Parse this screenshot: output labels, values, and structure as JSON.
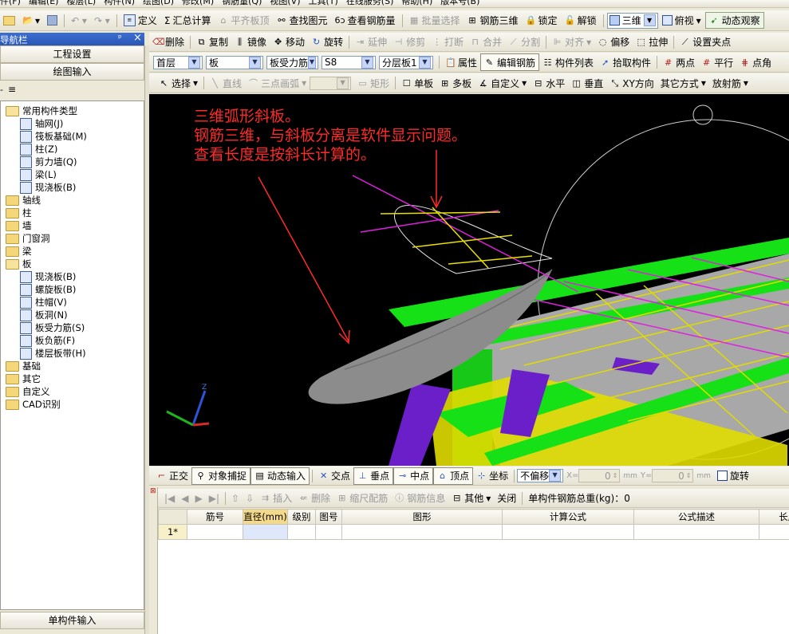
{
  "menu": [
    "件(F)",
    "编辑(E)",
    "楼层(L)",
    "构件(N)",
    "绘图(D)",
    "修改(M)",
    "钢筋量(Q)",
    "视图(V)",
    "工具(T)",
    "在线服务(S)",
    "帮助(H)",
    "版本号(B)"
  ],
  "toolbar1": {
    "define": "定义",
    "sum": "汇总计算",
    "flat_top": "平齐板顶",
    "find": "查找图元",
    "view_rebar": "查看钢筋量",
    "batch_select": "批量选择",
    "rebar_3d": "钢筋三维",
    "lock": "锁定",
    "unlock": "解锁",
    "view_mode": "三维",
    "view_angle": "俯视",
    "dynamic": "动态观察"
  },
  "toolbar2": {
    "delete": "删除",
    "copy": "复制",
    "mirror": "镜像",
    "move": "移动",
    "rotate": "旋转",
    "extend": "延伸",
    "trim": "修剪",
    "break": "打断",
    "merge": "合并",
    "split": "分割",
    "align": "对齐",
    "offset": "偏移",
    "stretch": "拉伸",
    "set_pinch": "设置夹点"
  },
  "toolbar3": {
    "floor": "首层",
    "category": "板",
    "type": "板受力筋",
    "name": "S8",
    "layer": "分层板1",
    "property": "属性",
    "edit_rebar": "编辑钢筋",
    "component_list": "构件列表",
    "pick": "拾取构件",
    "two_points": "两点",
    "parallel": "平行",
    "point_angle": "点角"
  },
  "toolbar4": {
    "select": "选择",
    "line": "直线",
    "arc": "三点画弧",
    "rect": "矩形",
    "single": "单板",
    "multi": "多板",
    "custom": "自定义",
    "horizontal": "水平",
    "vertical": "垂直",
    "xy": "XY方向",
    "other": "其它方式",
    "radial": "放射筋"
  },
  "left_panel": {
    "title": "导航栏",
    "btn_project": "工程设置",
    "btn_draw": "绘图输入",
    "btn_single": "单构件输入",
    "tree": [
      {
        "label": "常用构件类型",
        "level": 0,
        "kind": "folder-open"
      },
      {
        "label": "轴网(J)",
        "level": 1,
        "kind": "leaf"
      },
      {
        "label": "筏板基础(M)",
        "level": 1,
        "kind": "leaf"
      },
      {
        "label": "柱(Z)",
        "level": 1,
        "kind": "leaf"
      },
      {
        "label": "剪力墙(Q)",
        "level": 1,
        "kind": "leaf"
      },
      {
        "label": "梁(L)",
        "level": 1,
        "kind": "leaf"
      },
      {
        "label": "现浇板(B)",
        "level": 1,
        "kind": "leaf"
      },
      {
        "label": "轴线",
        "level": 0,
        "kind": "folder"
      },
      {
        "label": "柱",
        "level": 0,
        "kind": "folder"
      },
      {
        "label": "墙",
        "level": 0,
        "kind": "folder"
      },
      {
        "label": "门窗洞",
        "level": 0,
        "kind": "folder"
      },
      {
        "label": "梁",
        "level": 0,
        "kind": "folder"
      },
      {
        "label": "板",
        "level": 0,
        "kind": "folder-open"
      },
      {
        "label": "现浇板(B)",
        "level": 1,
        "kind": "leaf"
      },
      {
        "label": "螺旋板(B)",
        "level": 1,
        "kind": "leaf"
      },
      {
        "label": "柱帽(V)",
        "level": 1,
        "kind": "leaf"
      },
      {
        "label": "板洞(N)",
        "level": 1,
        "kind": "leaf"
      },
      {
        "label": "板受力筋(S)",
        "level": 1,
        "kind": "leaf"
      },
      {
        "label": "板负筋(F)",
        "level": 1,
        "kind": "leaf"
      },
      {
        "label": "楼层板带(H)",
        "level": 1,
        "kind": "leaf"
      },
      {
        "label": "基础",
        "level": 0,
        "kind": "folder"
      },
      {
        "label": "其它",
        "level": 0,
        "kind": "folder"
      },
      {
        "label": "自定义",
        "level": 0,
        "kind": "folder"
      },
      {
        "label": "CAD识别",
        "level": 0,
        "kind": "folder"
      }
    ]
  },
  "viewport": {
    "annotation": [
      "三维弧形斜板。",
      "钢筋三维，与斜板分离是软件显示问题。",
      "查看长度是按斜长计算的。"
    ],
    "colors": {
      "bg": "#000000",
      "annotation": "#ff2a2a",
      "slab": "#a8a8a8",
      "beam_green": "#16e016",
      "beam_yellow": "#e0dc00",
      "rebar_magenta": "#e020e0",
      "column_purple": "#6a1fc9"
    }
  },
  "statusbar": {
    "ortho": "正交",
    "snap": "对象捕捉",
    "dynamic_input": "动态输入",
    "intersection": "交点",
    "perpendicular": "垂点",
    "midpoint": "中点",
    "vertex": "顶点",
    "coordinate": "坐标",
    "offset_mode": "不偏移",
    "x_label": "X=",
    "x_value": "0",
    "y_label": "Y=",
    "y_value": "0",
    "unit": "mm",
    "rotate": "旋转"
  },
  "rebar_table": {
    "toolbar": {
      "insert": "插入",
      "delete": "删除",
      "scale": "缩尺配筋",
      "info": "钢筋信息",
      "other": "其他",
      "close": "关闭",
      "total": "单构件钢筋总重(kg)：0"
    },
    "columns": [
      "筋号",
      "直径(mm)",
      "级别",
      "图号",
      "图形",
      "计算公式",
      "公式描述",
      "长度("
    ],
    "rows": [
      {
        "index": "1*",
        "cells": [
          "",
          "",
          "",
          "",
          "",
          "",
          "",
          ""
        ]
      }
    ]
  }
}
